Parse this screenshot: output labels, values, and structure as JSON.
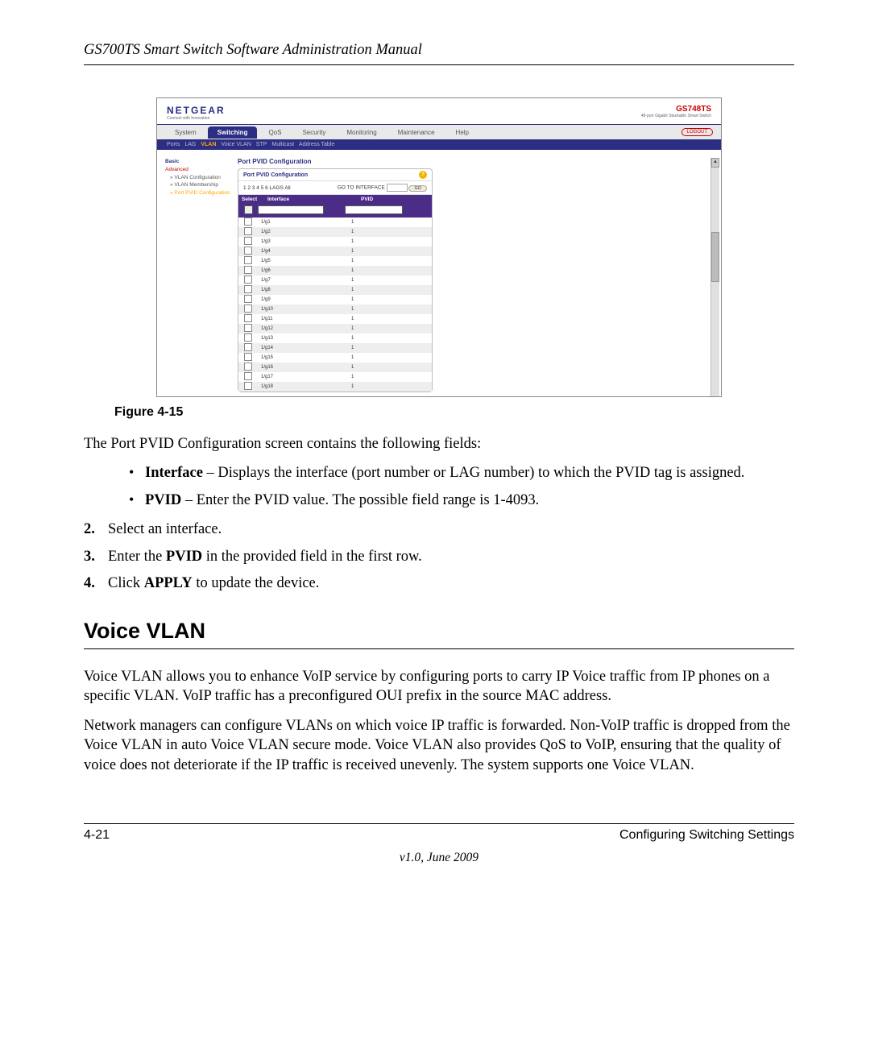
{
  "doc": {
    "running_head": "GS700TS Smart Switch Software Administration Manual",
    "figure_caption": "Figure 4-15",
    "intro_line": "The Port PVID Configuration screen contains the following fields:",
    "bullet_items": [
      {
        "term": "Interface",
        "desc": " – Displays the interface (port number or LAG number) to which the PVID tag is assigned."
      },
      {
        "term": "PVID",
        "desc": " – Enter the PVID value. The possible field range is 1-4093."
      }
    ],
    "steps": [
      {
        "n": "2.",
        "text_pre": "Select an interface."
      },
      {
        "n": "3.",
        "text_pre": "Enter the ",
        "bold": "PVID",
        "text_post": " in the provided field in the first row."
      },
      {
        "n": "4.",
        "text_pre": "Click ",
        "bold": "APPLY",
        "text_post": " to update the device."
      }
    ],
    "section_heading": "Voice VLAN",
    "section_p1": "Voice VLAN allows you to enhance VoIP service by configuring ports to carry IP Voice traffic from IP phones on a specific VLAN. VoIP traffic has a preconfigured OUI prefix in the source MAC address.",
    "section_p2": "Network managers can configure VLANs on which voice IP traffic is forwarded. Non-VoIP traffic is dropped from the Voice VLAN in auto Voice VLAN secure mode. Voice VLAN also provides QoS to VoIP, ensuring that the quality of voice does not deteriorate if the IP traffic is received unevenly. The system supports one Voice VLAN.",
    "footer_left": "4-21",
    "footer_right": "Configuring Switching Settings",
    "footer_version": "v1.0, June 2009"
  },
  "screenshot": {
    "brand": "NETGEAR",
    "brand_tag": "Connect with Innovation",
    "model": "GS748TS",
    "model_tag": "48-port Gigabit Stackable Smart Switch",
    "logout": "LOGOUT",
    "main_menu": [
      "System",
      "Switching",
      "QoS",
      "Security",
      "Monitoring",
      "Maintenance",
      "Help"
    ],
    "main_menu_active": "Switching",
    "sub_menu": [
      "Ports",
      "LAG",
      "VLAN",
      "Voice VLAN",
      "STP",
      "Multicast",
      "Address Table"
    ],
    "sub_menu_active": "VLAN",
    "side_items": {
      "basic": "Basic",
      "advanced": "Advanced",
      "vlan_conf": "VLAN Configuration",
      "vlan_memb": "VLAN Membership",
      "port_pvid": "Port PVID Configuration"
    },
    "content_title": "Port PVID Configuration",
    "panel_title": "Port PVID Configuration",
    "panel_row1_left": "1 2 3 4 5 6 LAGS All",
    "panel_row1_label": "GO TO INTERFACE",
    "panel_go": "GO",
    "table_headers": {
      "select": "Select",
      "interface": "Interface",
      "pvid": "PVID"
    },
    "rows": [
      {
        "if": "1/g1",
        "pvid": "1"
      },
      {
        "if": "1/g2",
        "pvid": "1"
      },
      {
        "if": "1/g3",
        "pvid": "1"
      },
      {
        "if": "1/g4",
        "pvid": "1"
      },
      {
        "if": "1/g5",
        "pvid": "1"
      },
      {
        "if": "1/g6",
        "pvid": "1"
      },
      {
        "if": "1/g7",
        "pvid": "1"
      },
      {
        "if": "1/g8",
        "pvid": "1"
      },
      {
        "if": "1/g9",
        "pvid": "1"
      },
      {
        "if": "1/g10",
        "pvid": "1"
      },
      {
        "if": "1/g11",
        "pvid": "1"
      },
      {
        "if": "1/g12",
        "pvid": "1"
      },
      {
        "if": "1/g13",
        "pvid": "1"
      },
      {
        "if": "1/g14",
        "pvid": "1"
      },
      {
        "if": "1/g15",
        "pvid": "1"
      },
      {
        "if": "1/g16",
        "pvid": "1"
      },
      {
        "if": "1/g17",
        "pvid": "1"
      },
      {
        "if": "1/g18",
        "pvid": "1"
      }
    ]
  }
}
